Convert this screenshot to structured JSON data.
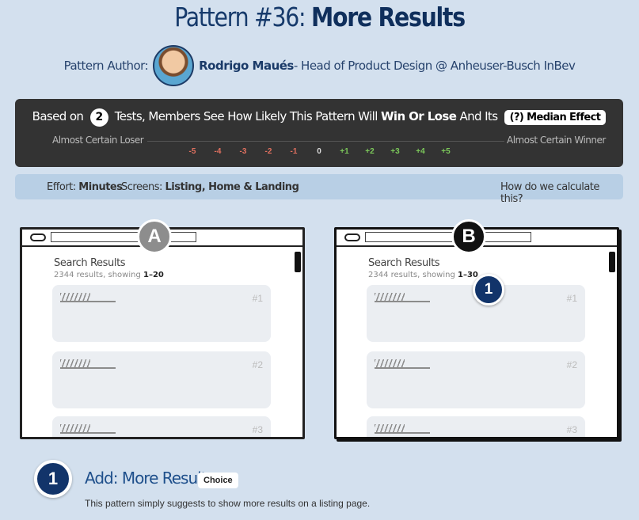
{
  "header": {
    "title_prefix": "Pattern #36: ",
    "title_name": "More Results",
    "author_label": "Pattern Author:",
    "author_name": "Rodrigo Maués",
    "author_role": " - Head of Product Design @ Anheuser-Busch InBev"
  },
  "summary": {
    "based_on": "Based on",
    "tests_count": "2",
    "text_mid": "Tests, Members See How Likely This Pattern Will",
    "win_or_lose": "Win Or Lose",
    "and_its": "And Its",
    "median_effect": "(?) Median Effect",
    "left_label": "Almost Certain Loser",
    "right_label": "Almost Certain Winner",
    "ticks": [
      {
        "label": "-5",
        "color": "#e0705f"
      },
      {
        "label": "-4",
        "color": "#e0705f"
      },
      {
        "label": "-3",
        "color": "#e0705f"
      },
      {
        "label": "-2",
        "color": "#e0705f"
      },
      {
        "label": "-1",
        "color": "#e0705f"
      },
      {
        "label": "0",
        "color": "#dddddd"
      },
      {
        "label": "+1",
        "color": "#7cc85a"
      },
      {
        "label": "+2",
        "color": "#7cc85a"
      },
      {
        "label": "+3",
        "color": "#7cc85a"
      },
      {
        "label": "+4",
        "color": "#7cc85a"
      },
      {
        "label": "+5",
        "color": "#7cc85a"
      }
    ]
  },
  "effort": {
    "effort_label": "Effort:",
    "effort_value": "Minutes",
    "screens_label": "Screens:",
    "screens_value": "Listing, Home & Landing",
    "how_link": "How do we calculate this?"
  },
  "variants": {
    "a": {
      "letter": "A",
      "title": "Search Results",
      "sub_prefix": "2344 results, showing ",
      "sub_range": "1–20",
      "cards": [
        "#1",
        "#2",
        "#3"
      ]
    },
    "b": {
      "letter": "B",
      "title": "Search Results",
      "sub_prefix": "2344 results, showing ",
      "sub_range": "1–30",
      "marker": "1",
      "cards": [
        "#1",
        "#2",
        "#3"
      ]
    }
  },
  "change": {
    "number": "1",
    "title": "Add: More Results",
    "tag": "Choice",
    "description": "This pattern simply suggests to show more results on a listing page."
  }
}
